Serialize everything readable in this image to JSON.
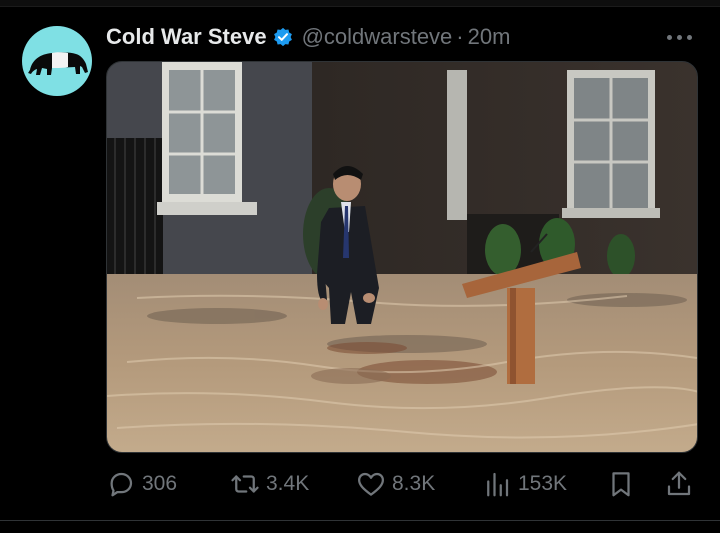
{
  "tweet": {
    "author_name": "Cold War Steve",
    "handle": "@coldwarsteve",
    "separator": "·",
    "time": "20m"
  },
  "actions": {
    "replies": "306",
    "reposts": "3.4K",
    "likes": "8.3K",
    "views": "153K"
  },
  "colors": {
    "background": "#000000",
    "text_primary": "#e7e9ea",
    "text_secondary": "#71767b",
    "verified_blue": "#1d9bf0",
    "avatar_bg": "#7fe0e4"
  },
  "icons": [
    "verified-badge-icon",
    "more-options-icon",
    "reply-icon",
    "repost-icon",
    "like-icon",
    "views-icon",
    "bookmark-icon",
    "share-icon"
  ]
}
